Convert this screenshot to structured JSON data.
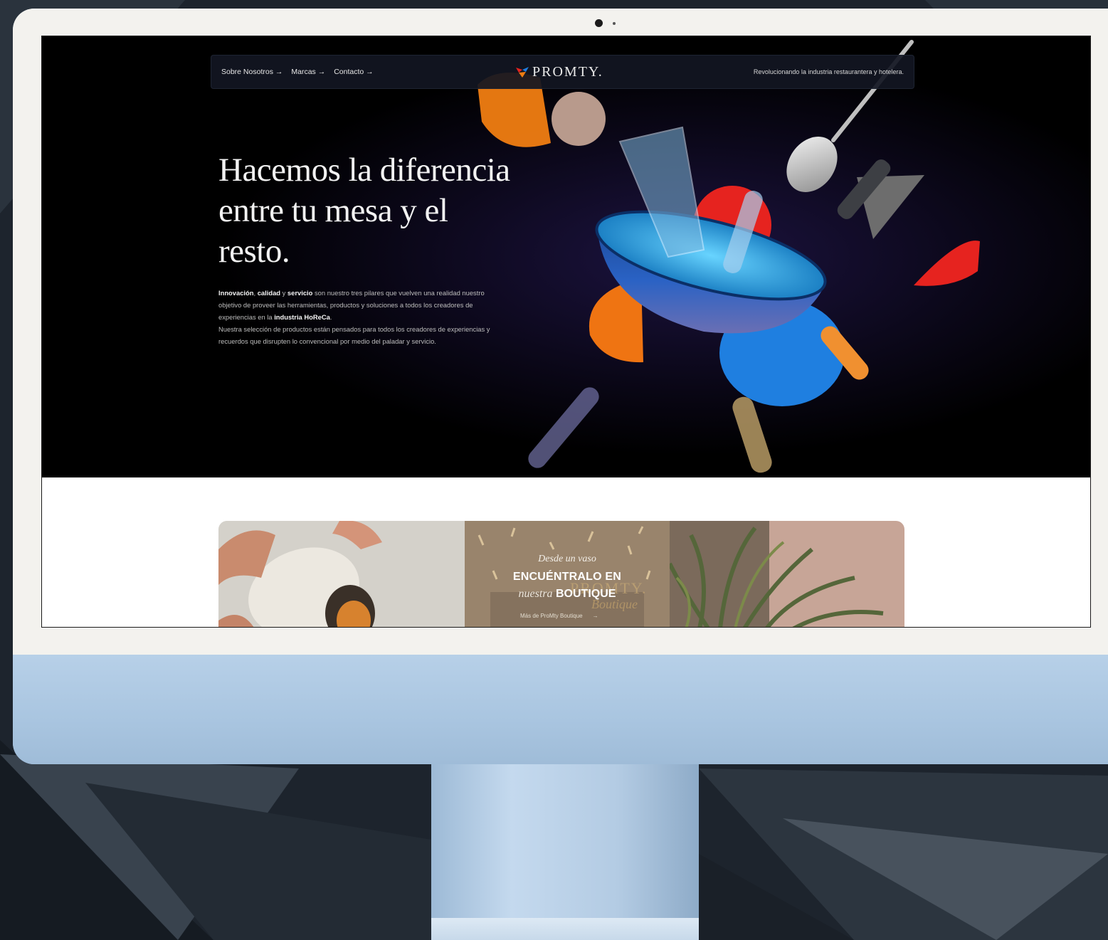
{
  "nav": {
    "links": [
      {
        "label": "Sobre Nosotros →"
      },
      {
        "label": "Marcas →"
      },
      {
        "label": "Contacto →"
      }
    ],
    "logo_text": "PROMTY.",
    "tagline": "Revolucionando la industria restaurantera y hotelera."
  },
  "hero": {
    "title": "Hacemos la diferencia entre tu mesa y el resto.",
    "body": {
      "b1": "Innovación",
      "t1": ", ",
      "b2": "calidad",
      "t2": " y ",
      "b3": "servicio",
      "t3": " son nuestro tres pilares que vuelven una realidad nuestro objetivo de proveer las herramientas, productos y soluciones a todos los creadores de experiencias en la ",
      "b4": "industria HoReCa",
      "t4": ".",
      "p2": "Nuestra selección de productos están pensados para todos los creadores de experiencias y recuerdos que disrupten lo convencional por medio del paladar y servicio."
    }
  },
  "boutique": {
    "subtitle": "Desde un vaso",
    "line1": "ENCUÉNTRALO EN",
    "line2_italic": "nuestra",
    "line2_bold": "BOUTIQUE",
    "ghost_logo": "PROMTY.",
    "ghost_sub": "Boutique",
    "link_label": "Más de ProMty Boutique",
    "link_arrow": "→"
  },
  "colors": {
    "hero_bg": "#000000",
    "bezel": "#f3f2ee",
    "chin": "#aec9e3",
    "accent_orange": "#f07d12",
    "accent_blue": "#1f7fe0",
    "accent_red": "#e6231f"
  },
  "icons": {
    "logo_mark": "promty-logo-icon",
    "camera": "camera-icon"
  }
}
